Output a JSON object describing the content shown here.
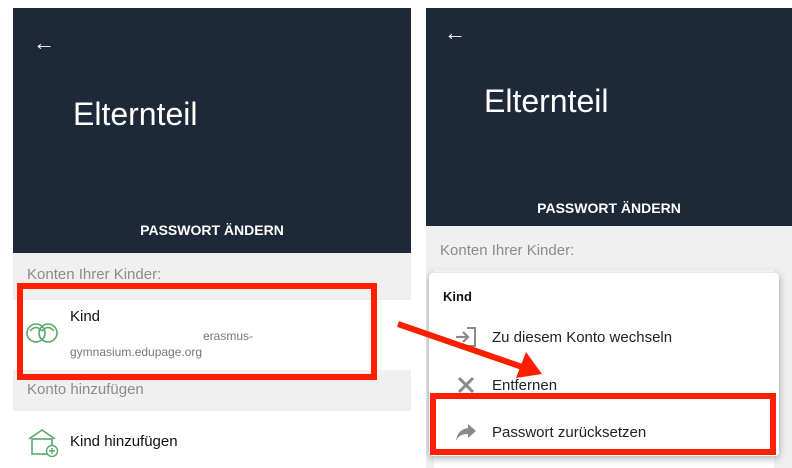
{
  "colors": {
    "header": "#1d2939",
    "highlight": "#ff1e00",
    "icon_green": "#5aa867"
  },
  "left": {
    "title": "Elternteil",
    "password_button": "PASSWORT ÄNDERN",
    "section_children": "Konten Ihrer Kinder:",
    "child": {
      "name": "Kind",
      "domain_line1": "erasmus-",
      "domain_line2": "gymnasium.edupage.org"
    },
    "section_add": "Konto hinzufügen",
    "add_child": "Kind hinzufügen"
  },
  "right": {
    "title": "Elternteil",
    "password_button": "PASSWORT ÄNDERN",
    "section_children": "Konten Ihrer Kinder:",
    "popup": {
      "title": "Kind",
      "items": [
        {
          "label": "Zu diesem Konto wechseln",
          "icon": "login-icon"
        },
        {
          "label": "Entfernen",
          "icon": "close-icon"
        },
        {
          "label": "Passwort zurücksetzen",
          "icon": "share-arrow-icon"
        }
      ]
    }
  }
}
